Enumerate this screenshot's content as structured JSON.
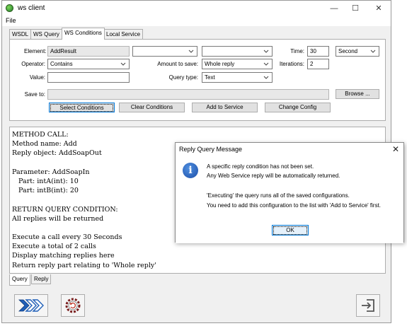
{
  "window": {
    "title": "ws client",
    "controls": {
      "minimize": "—",
      "maximize": "☐",
      "close": "✕"
    }
  },
  "menu": {
    "file": "File"
  },
  "tabs": [
    {
      "label": "WSDL"
    },
    {
      "label": "WS Query"
    },
    {
      "label": "WS Conditions",
      "active": true
    },
    {
      "label": "Local Service"
    }
  ],
  "conditions": {
    "element_label": "Element:",
    "element_value": "AddResult",
    "element_combo1": "",
    "element_combo2": "",
    "time_label": "Time:",
    "time_value": "30",
    "time_unit": "Second",
    "operator_label": "Operator:",
    "operator_value": "Contains",
    "amount_label": "Amount to save:",
    "amount_value": "Whole reply",
    "iterations_label": "Iterations:",
    "iterations_value": "2",
    "value_label": "Value:",
    "value_value": "",
    "query_type_label": "Query type:",
    "query_type_value": "Text",
    "save_to_label": "Save to:",
    "save_to_value": "",
    "browse_label": "Browse ...",
    "buttons": {
      "select": "Select Conditions",
      "clear": "Clear Conditions",
      "add": "Add to Service",
      "change": "Change Config"
    }
  },
  "output_lines": [
    "METHOD CALL:",
    "Method name: Add",
    "Reply object: AddSoapOut",
    "",
    "Parameter: AddSoapIn",
    "   Part: intA(int): 10",
    "   Part: intB(int): 20",
    "",
    "RETURN QUERY CONDITION:",
    "All replies will be returned",
    "",
    "Execute a call every 30 Seconds",
    "Execute a total of 2 calls",
    "Display matching replies here",
    "Return reply part relating to 'Whole reply'"
  ],
  "bottom_tabs": [
    {
      "label": "Query",
      "active": true
    },
    {
      "label": "Reply"
    }
  ],
  "toolbar_icons": {
    "run": "run-queries-icon",
    "settings": "settings-gear-icon",
    "exit": "exit-icon"
  },
  "dialog": {
    "title": "Reply Query Message",
    "close": "✕",
    "icon": "info-icon",
    "icon_glyph": "i",
    "lines": [
      "A specific reply condition has not been set.",
      "Any Web Service reply will be automatically returned.",
      "",
      "'Executing' the query runs all of the saved configurations.",
      "You need to add this configuration to the list with 'Add to Service' first."
    ],
    "ok_label": "OK"
  },
  "colors": {
    "accent": "#0078d7",
    "icon_blue": "#1d4fa8",
    "window_bg": "#f0f0f0"
  }
}
